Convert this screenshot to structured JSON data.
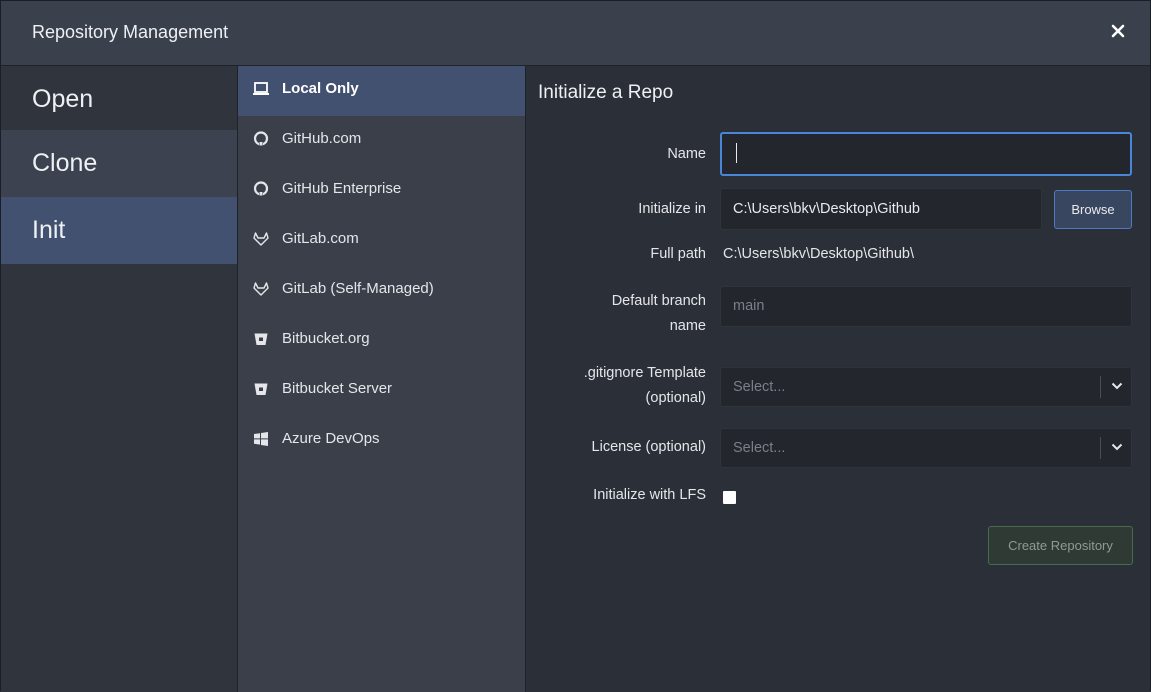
{
  "window": {
    "title": "Repository Management",
    "close_icon": "close-icon"
  },
  "modes": [
    {
      "label": "Open"
    },
    {
      "label": "Clone"
    },
    {
      "label": "Init"
    }
  ],
  "providers": [
    {
      "label": "Local Only",
      "icon": "laptop-icon"
    },
    {
      "label": "GitHub.com",
      "icon": "github-icon"
    },
    {
      "label": "GitHub Enterprise",
      "icon": "github-icon"
    },
    {
      "label": "GitLab.com",
      "icon": "gitlab-icon"
    },
    {
      "label": "GitLab (Self-Managed)",
      "icon": "gitlab-icon"
    },
    {
      "label": "Bitbucket.org",
      "icon": "bitbucket-icon"
    },
    {
      "label": "Bitbucket Server",
      "icon": "bitbucket-icon"
    },
    {
      "label": "Azure DevOps",
      "icon": "windows-icon"
    }
  ],
  "form": {
    "title": "Initialize a Repo",
    "name_label": "Name",
    "name_value": "",
    "init_in_label": "Initialize in",
    "init_in_value": "C:\\Users\\bkv\\Desktop\\Github",
    "browse_label": "Browse",
    "full_path_label": "Full path",
    "full_path_value": "C:\\Users\\bkv\\Desktop\\Github\\",
    "branch_label_1": "Default branch",
    "branch_label_2": "name",
    "branch_placeholder": "main",
    "gitignore_label_1": ".gitignore Template",
    "gitignore_label_2": "(optional)",
    "gitignore_placeholder": "Select...",
    "license_label": "License (optional)",
    "license_placeholder": "Select...",
    "lfs_label": "Initialize with LFS",
    "lfs_checked": false,
    "create_label": "Create Repository"
  },
  "colors": {
    "accent": "#4a86d8",
    "selected": "#435170",
    "create_border": "#476b4f"
  }
}
